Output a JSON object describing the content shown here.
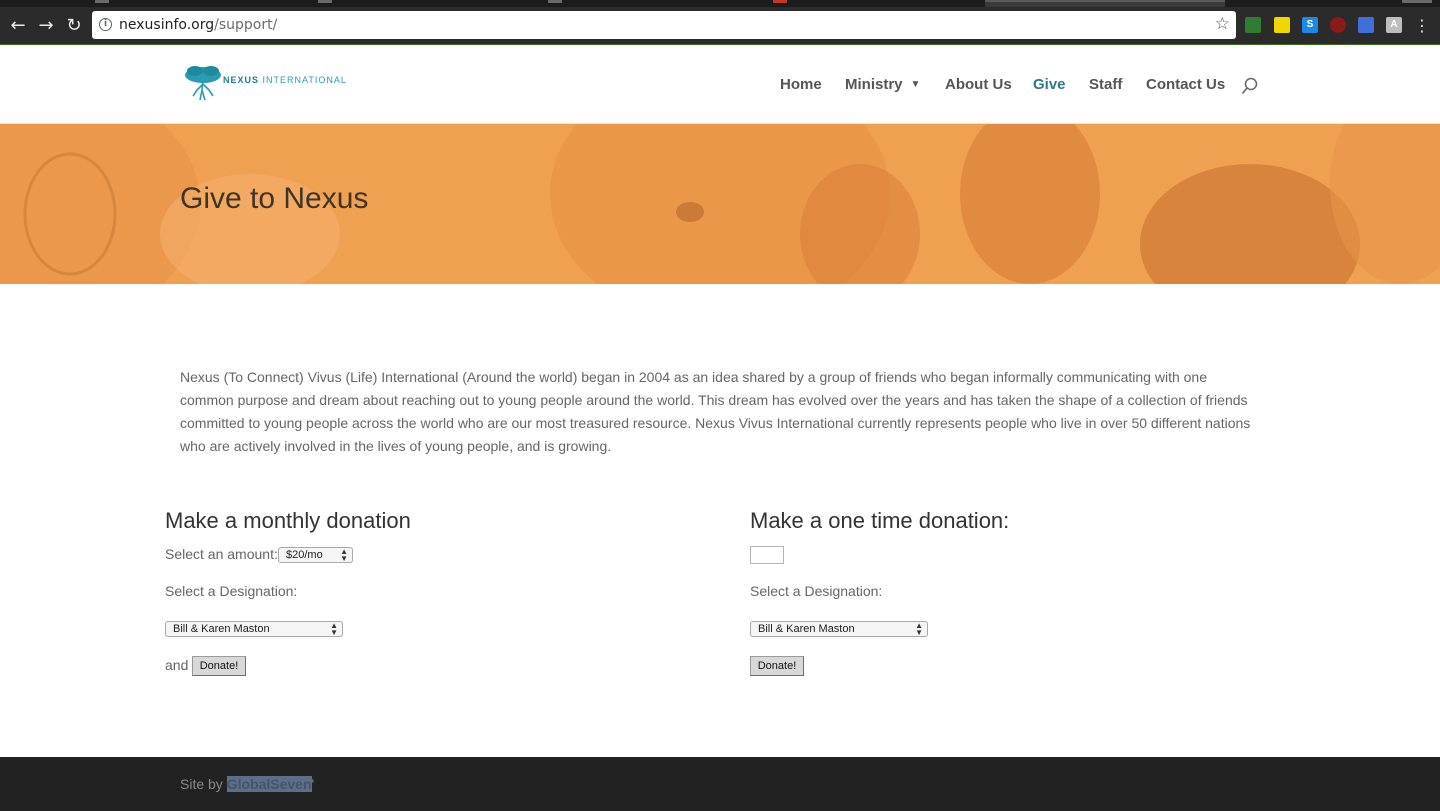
{
  "browser": {
    "url_host": "nexusinfo.org",
    "url_path": "/support/"
  },
  "site": {
    "logo_word_bold": "NEXUS",
    "logo_word_rest": "INTERNATIONAL",
    "nav": {
      "home": "Home",
      "ministry": "Ministry",
      "about": "About Us",
      "give": "Give",
      "staff": "Staff",
      "contact": "Contact Us"
    },
    "accent_color": "#2b7a8c",
    "hero_color": "#f0a051"
  },
  "hero": {
    "title": "Give to Nexus"
  },
  "intro": {
    "text": "Nexus (To Connect) Vivus (Life) International (Around the world) began in 2004 as an idea shared by a group of friends who began informally communicating with one common purpose and dream about reaching out to young people around the world. This dream has evolved over the years and has taken the shape of a collection of friends committed to young people across the world who are our most treasured resource. Nexus Vivus International currently represents people who live in over 50 different nations who are actively involved in the lives of young people, and is growing."
  },
  "monthly": {
    "heading": "Make a monthly donation",
    "amount_label": "Select an amount:",
    "amount_value": "$20/mo",
    "designation_label": "Select a Designation:",
    "designation_value": "Bill & Karen Maston",
    "and_label": "and",
    "donate_label": "Donate!"
  },
  "one_time": {
    "heading": "Make a one time donation:",
    "amount_value": "",
    "designation_label": "Select a Designation:",
    "designation_value": "Bill & Karen Maston",
    "donate_label": "Donate!"
  },
  "footer": {
    "prefix": "Site by ",
    "link": "GlobalSeven",
    "suffix": "'"
  }
}
